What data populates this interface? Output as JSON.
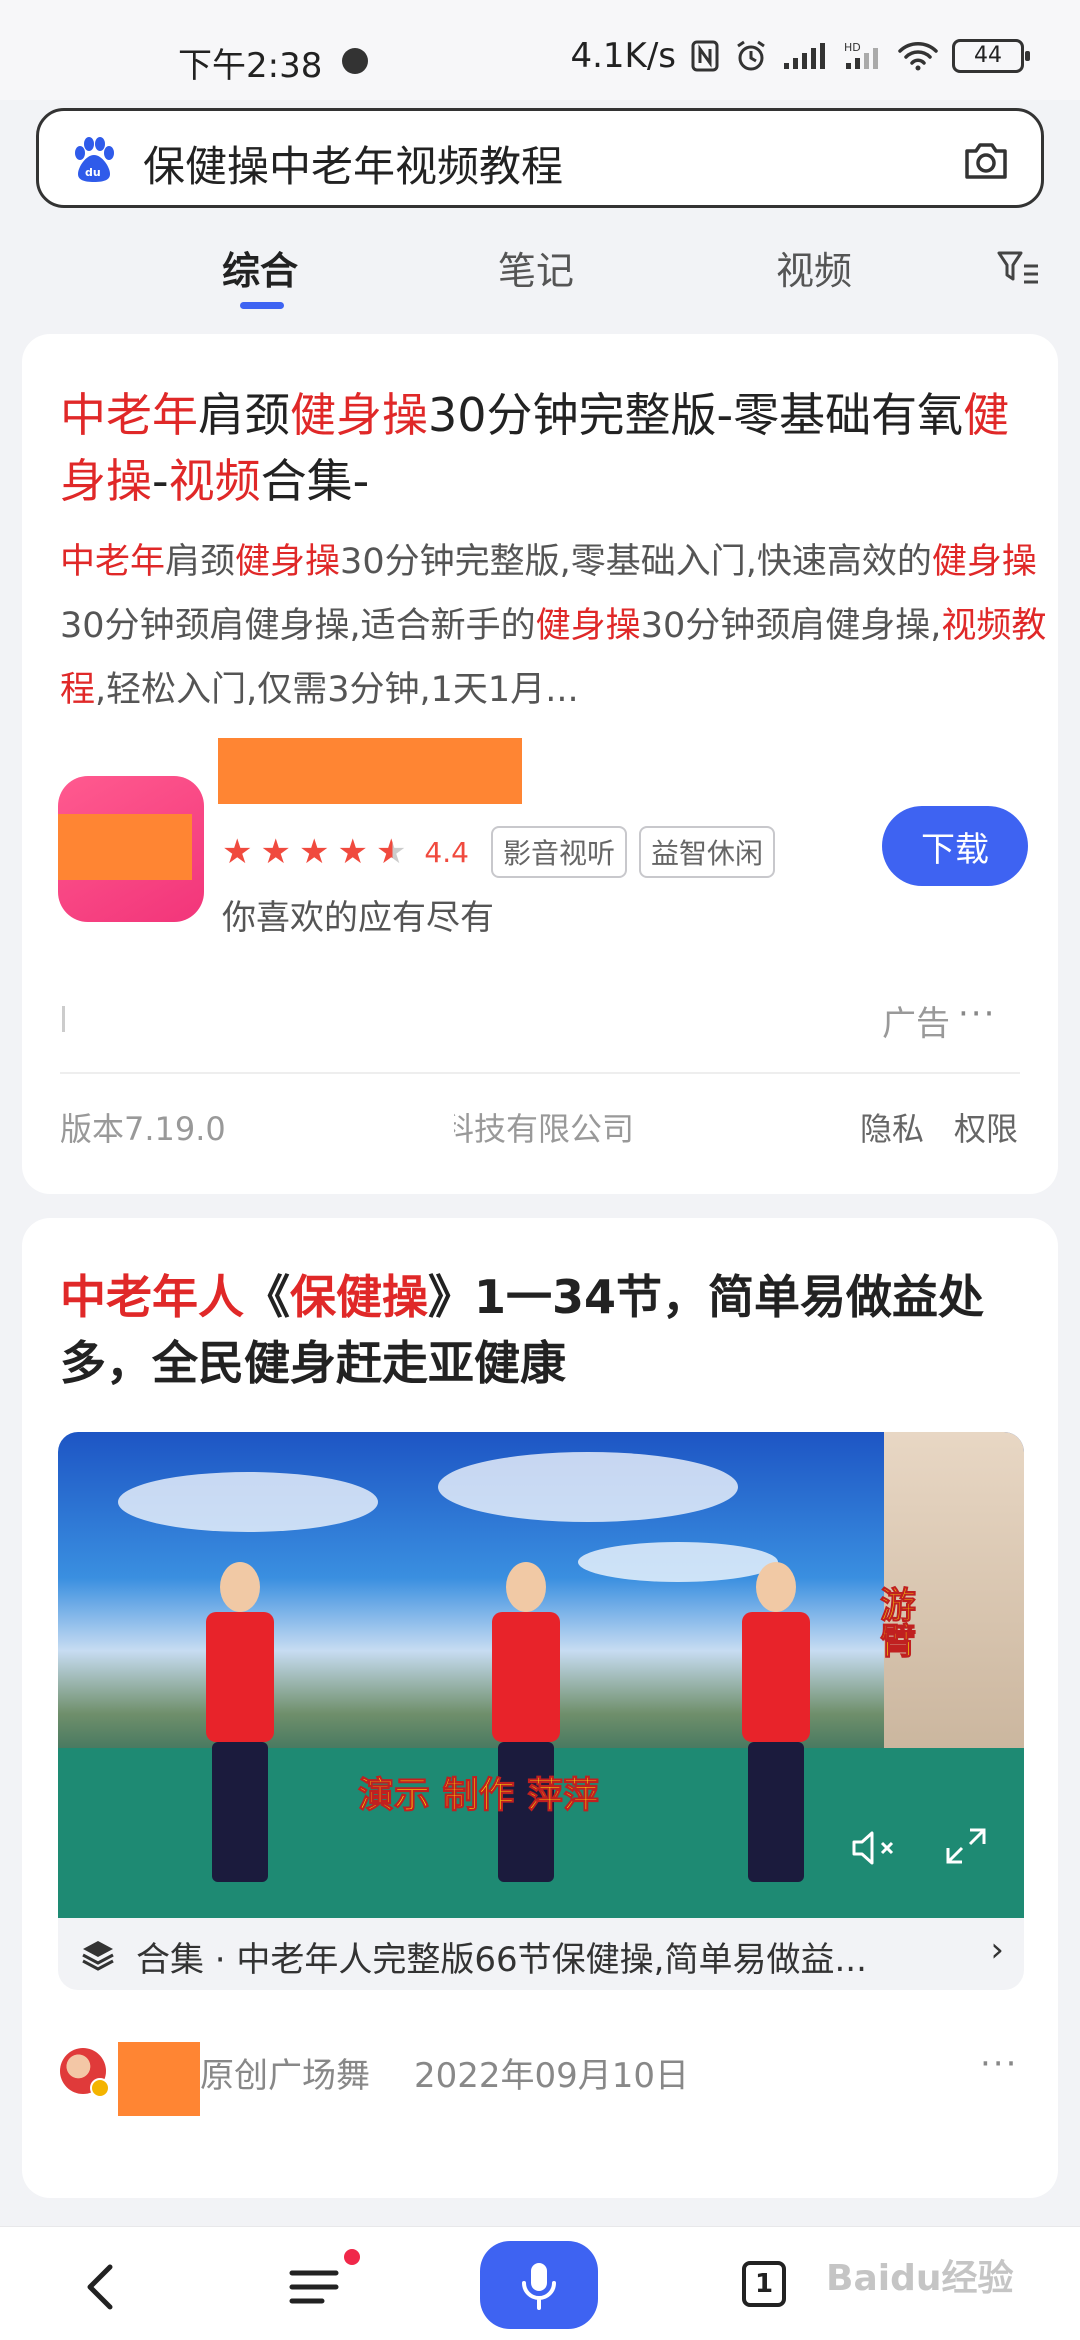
{
  "status_bar": {
    "time": "下午2:38",
    "network_speed": "4.1K/s",
    "battery": "44"
  },
  "search": {
    "query": "保健操中老年视频教程"
  },
  "tabs": [
    {
      "label": "综合",
      "active": true
    },
    {
      "label": "笔记",
      "active": false
    },
    {
      "label": "视频",
      "active": false
    }
  ],
  "ad_result": {
    "title": [
      {
        "text": "中老年",
        "hl": true
      },
      {
        "text": "肩颈",
        "hl": false
      },
      {
        "text": "健身操",
        "hl": true
      },
      {
        "text": "30分钟完整版-零基础有氧",
        "hl": false
      },
      {
        "text": "健身操",
        "hl": true
      },
      {
        "text": "-",
        "hl": false
      },
      {
        "text": "视频",
        "hl": true
      },
      {
        "text": "合集-",
        "hl": false
      }
    ],
    "abstract": [
      {
        "text": "中老年",
        "hl": true
      },
      {
        "text": "肩颈",
        "hl": false
      },
      {
        "text": "健身操",
        "hl": true
      },
      {
        "text": "30分钟完整版,零基础入门,快速高效的",
        "hl": false
      },
      {
        "text": "健身操",
        "hl": true
      },
      {
        "text": "30分钟颈肩健身操,适合新手的",
        "hl": false
      },
      {
        "text": "健身操",
        "hl": true
      },
      {
        "text": "30分钟颈肩健身操,",
        "hl": false
      },
      {
        "text": "视频教程",
        "hl": true
      },
      {
        "text": ",轻松入门,仅需3分钟,1天1月...",
        "hl": false
      }
    ],
    "app": {
      "rating": "4.4",
      "rating_fraction": 0.88,
      "tags": [
        "影音视听",
        "益智休闲"
      ],
      "slogan": "你喜欢的应有尽有",
      "download_label": "下载"
    },
    "ad_label": "广告",
    "more": "···",
    "version": "版本7.19.0",
    "company": "科技有限公司",
    "privacy": "隐私",
    "permissions": "权限"
  },
  "video_result": {
    "title": [
      {
        "text": "中老年人",
        "hl": true
      },
      {
        "text": "《",
        "hl": false
      },
      {
        "text": "保健操",
        "hl": true
      },
      {
        "text": "》1一34节，简单易做益处多，全民健身赶走亚健康",
        "hl": false
      }
    ],
    "thumb_caption_1": "演示 制作 萍萍",
    "thumb_caption_2": "游臂",
    "collection": "合集 · 中老年人完整版66节保健操,简单易做益...",
    "collection_chevron": "›",
    "author": "原创广场舞",
    "date": "2022年09月10日",
    "more": "···"
  },
  "bottom_nav": {
    "tab_count": "1",
    "watermark": "Baidu经验"
  },
  "colors": {
    "accent": "#3e63f2",
    "highlight": "#e02828",
    "masked": "#ff8533"
  }
}
